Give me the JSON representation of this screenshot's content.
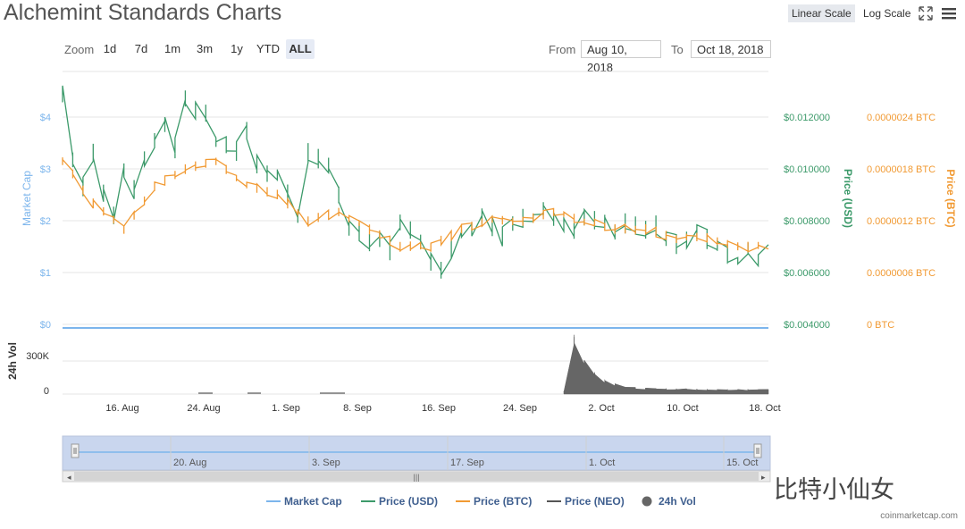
{
  "header": {
    "title": "Alchemint Standards Charts",
    "linear_label": "Linear Scale",
    "log_label": "Log Scale"
  },
  "zoom": {
    "label": "Zoom",
    "buttons": [
      "1d",
      "7d",
      "1m",
      "3m",
      "1y",
      "YTD",
      "ALL"
    ],
    "active": "ALL"
  },
  "range": {
    "from_label": "From",
    "from_value": "Aug 10, 2018",
    "to_label": "To",
    "to_value": "Oct 18, 2018"
  },
  "watermark": "比特小仙女",
  "credit": "coinmarketcap.com",
  "colors": {
    "market_cap": "#7cb5ec",
    "price_usd": "#3c9a6a",
    "price_btc": "#f19a33",
    "price_neo": "#555555",
    "volume": "#666666",
    "grid": "#e6e6e6",
    "navigator": "#c9d6ee"
  },
  "chart_data": {
    "type": "line",
    "x_tick_labels": [
      "16. Aug",
      "24. Aug",
      "1. Sep",
      "8. Sep",
      "16. Sep",
      "24. Sep",
      "2. Oct",
      "10. Oct",
      "18. Oct"
    ],
    "x_range": [
      "2018-08-10",
      "2018-10-18"
    ],
    "axes": {
      "market_cap": {
        "label": "Market Cap",
        "ticks": [
          "$0",
          "$1",
          "$2",
          "$3",
          "$4"
        ]
      },
      "price_usd": {
        "label": "Price (USD)",
        "ticks": [
          "$0.004000",
          "$0.006000",
          "$0.008000",
          "$0.010000",
          "$0.012000"
        ],
        "range": [
          0.004,
          0.0132
        ]
      },
      "price_btc": {
        "label": "Price (BTC)",
        "ticks": [
          "0 BTC",
          "0.0000006 BTC",
          "0.0000012 BTC",
          "0.0000018 BTC",
          "0.0000024 BTC"
        ]
      },
      "volume": {
        "label": "24h Vol",
        "ticks": [
          "0",
          "300K"
        ],
        "range": [
          0,
          600000
        ]
      }
    },
    "series": [
      {
        "name": "Market Cap",
        "values": [
          0,
          0
        ]
      },
      {
        "name": "Price (USD)",
        "x": [
          "2018-08-10",
          "2018-08-11",
          "2018-08-12",
          "2018-08-13",
          "2018-08-14",
          "2018-08-15",
          "2018-08-16",
          "2018-08-17",
          "2018-08-18",
          "2018-08-19",
          "2018-08-20",
          "2018-08-21",
          "2018-08-22",
          "2018-08-23",
          "2018-08-24",
          "2018-08-25",
          "2018-08-26",
          "2018-08-27",
          "2018-08-28",
          "2018-08-29",
          "2018-08-30",
          "2018-08-31",
          "2018-09-01",
          "2018-09-02",
          "2018-09-03",
          "2018-09-04",
          "2018-09-05",
          "2018-09-06",
          "2018-09-07",
          "2018-09-08",
          "2018-09-09",
          "2018-09-10",
          "2018-09-11",
          "2018-09-12",
          "2018-09-13",
          "2018-09-14",
          "2018-09-15",
          "2018-09-16",
          "2018-09-17",
          "2018-09-18",
          "2018-09-19",
          "2018-09-20",
          "2018-09-21",
          "2018-09-22",
          "2018-09-23",
          "2018-09-24",
          "2018-09-25",
          "2018-09-26",
          "2018-09-27",
          "2018-09-28",
          "2018-09-29",
          "2018-09-30",
          "2018-10-01",
          "2018-10-02",
          "2018-10-03",
          "2018-10-04",
          "2018-10-05",
          "2018-10-06",
          "2018-10-07",
          "2018-10-08",
          "2018-10-09",
          "2018-10-10",
          "2018-10-11",
          "2018-10-12",
          "2018-10-13",
          "2018-10-14",
          "2018-10-15",
          "2018-10-16",
          "2018-10-17",
          "2018-10-18"
        ],
        "values": [
          0.0129,
          0.0104,
          0.0093,
          0.0106,
          0.009,
          0.0082,
          0.01,
          0.0092,
          0.0104,
          0.011,
          0.0118,
          0.0108,
          0.0127,
          0.0123,
          0.0122,
          0.0112,
          0.011,
          0.0107,
          0.0115,
          0.0102,
          0.0098,
          0.0096,
          0.009,
          0.008,
          0.0106,
          0.0104,
          0.0101,
          0.009,
          0.0078,
          0.0076,
          0.0072,
          0.0072,
          0.0068,
          0.0079,
          0.0076,
          0.0072,
          0.0064,
          0.0061,
          0.0069,
          0.0076,
          0.0078,
          0.0081,
          0.0078,
          0.0074,
          0.008,
          0.0081,
          0.0083,
          0.0084,
          0.008,
          0.0079,
          0.0077,
          0.0082,
          0.008,
          0.0079,
          0.0076,
          0.0079,
          0.0078,
          0.0077,
          0.0078,
          0.0074,
          0.0071,
          0.0072,
          0.0075,
          0.0073,
          0.007,
          0.0067,
          0.0066,
          0.007,
          0.0066,
          0.0068
        ]
      },
      {
        "name": "Price (BTC)",
        "x": [
          "2018-08-10",
          "2018-08-13",
          "2018-08-16",
          "2018-08-19",
          "2018-08-22",
          "2018-08-25",
          "2018-08-28",
          "2018-08-31",
          "2018-09-03",
          "2018-09-06",
          "2018-09-09",
          "2018-09-12",
          "2018-09-15",
          "2018-09-18",
          "2018-09-21",
          "2018-09-24",
          "2018-09-27",
          "2018-09-30",
          "2018-10-03",
          "2018-10-06",
          "2018-10-09",
          "2018-10-12",
          "2018-10-15",
          "2018-10-18"
        ],
        "values": [
          1.9e-06,
          1.4e-06,
          1.1e-06,
          1.6e-06,
          1.8e-06,
          1.9e-06,
          1.6e-06,
          1.5e-06,
          1.2e-06,
          1.3e-06,
          1.1e-06,
          9e-07,
          9e-07,
          1.1e-06,
          1.2e-06,
          1.2e-06,
          1.3e-06,
          1.2e-06,
          1.1e-06,
          1.1e-06,
          1e-06,
          1e-06,
          9e-07,
          9e-07
        ]
      },
      {
        "name": "Price (NEO)",
        "values": []
      },
      {
        "name": "24h Vol",
        "x": [
          "2018-09-28",
          "2018-09-29",
          "2018-09-30",
          "2018-10-01",
          "2018-10-02",
          "2018-10-04",
          "2018-10-06",
          "2018-10-10",
          "2018-10-14",
          "2018-10-18"
        ],
        "values": [
          20000,
          530000,
          280000,
          180000,
          120000,
          60000,
          50000,
          45000,
          40000,
          40000
        ]
      }
    ],
    "navigator_labels": [
      "20. Aug",
      "3. Sep",
      "17. Sep",
      "1. Oct",
      "15. Oct"
    ],
    "legend": [
      "Market Cap",
      "Price (USD)",
      "Price (BTC)",
      "Price (NEO)",
      "24h Vol"
    ],
    "legend_position": "bottom"
  }
}
